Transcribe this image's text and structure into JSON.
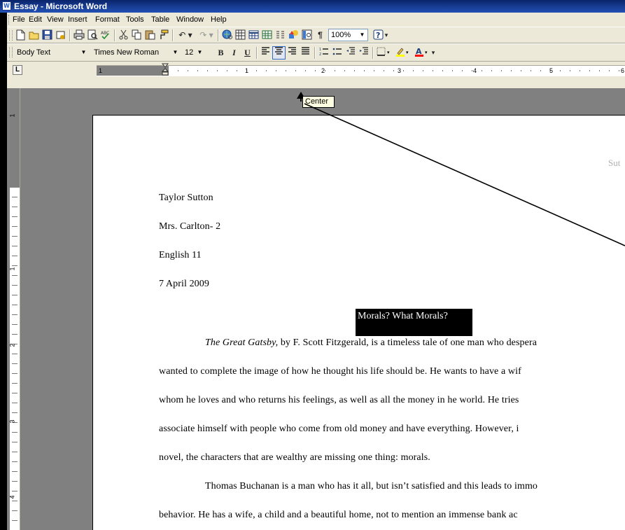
{
  "window": {
    "title": "Essay - Microsoft Word",
    "app_icon": "word-icon"
  },
  "menu": {
    "items": [
      {
        "label": "File"
      },
      {
        "label": "Edit"
      },
      {
        "label": "View"
      },
      {
        "label": "Insert"
      },
      {
        "label": "Format"
      },
      {
        "label": "Tools"
      },
      {
        "label": "Table"
      },
      {
        "label": "Window"
      },
      {
        "label": "Help"
      }
    ]
  },
  "standard_toolbar": {
    "zoom": "100%"
  },
  "formatting_toolbar": {
    "style": "Body Text",
    "font": "Times New Roman",
    "size": "12"
  },
  "ruler": {
    "numbers": [
      "1",
      "1",
      "2",
      "3",
      "4",
      "5",
      "6"
    ],
    "tab_type": "Center"
  },
  "vertical_ruler": {
    "numbers": [
      "1",
      "1",
      "2",
      "3",
      "4"
    ]
  },
  "tooltip": {
    "text": "Center"
  },
  "document": {
    "header": "Sut",
    "heading_lines": [
      "Taylor Sutton",
      "Mrs. Carlton- 2",
      "English 11",
      "7 April 2009"
    ],
    "title": "Morals? What Morals?",
    "para1": {
      "italic_start": "The Great Gatsby,",
      "line1_rest": " by F. Scott Fitzgerald, is a timeless tale of one man who despera",
      "lines": [
        "wanted to complete the image of how he thought his life should be. He wants to have a wif",
        "whom he loves and who returns his feelings, as well as all the money in he world. He tries",
        "associate himself with people who come from old money and have everything.  However, i",
        "novel, the characters that are wealthy are missing one thing: morals."
      ]
    },
    "para2": {
      "line1": "Thomas Buchanan is a man who has it all, but isn’t satisfied and this leads to immo",
      "line2": "behavior.  He has a wife, a child and a beautiful home, not to mention an immense bank ac"
    }
  }
}
